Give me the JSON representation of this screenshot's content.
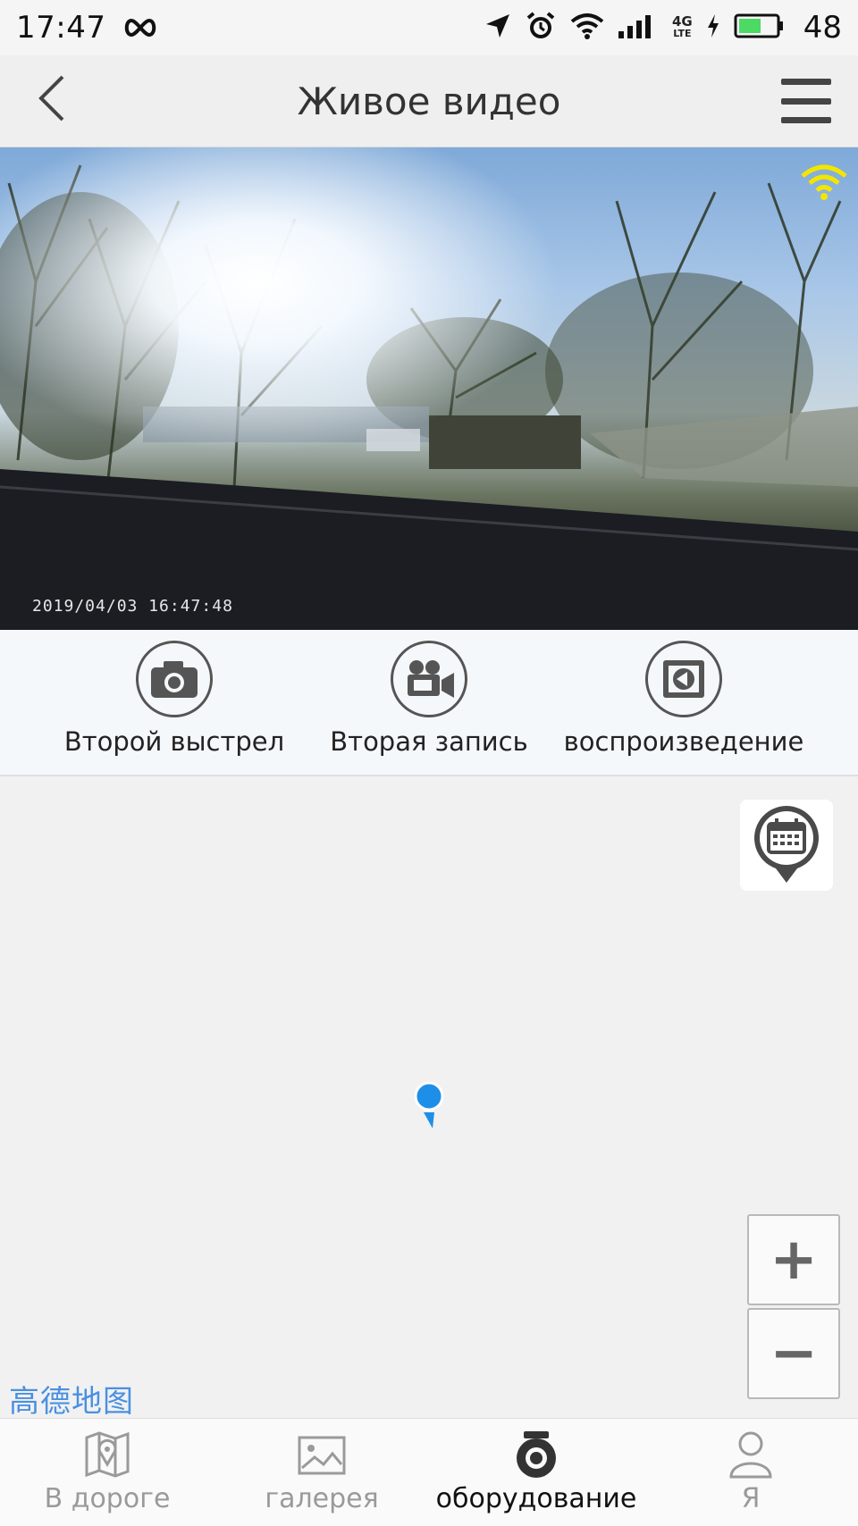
{
  "status_bar": {
    "time": "17:47",
    "battery_percent": "48",
    "network_label": "4G",
    "network_sub": "LTE",
    "icons": [
      "infinity-icon",
      "location-arrow-icon",
      "alarm-icon",
      "wifi-icon",
      "signal-icon",
      "charging-icon",
      "battery-icon"
    ]
  },
  "header": {
    "title": "Живое видео",
    "back_icon": "chevron-left-icon",
    "menu_icon": "hamburger-menu-icon"
  },
  "video": {
    "timestamp": "2019/04/03  16:47:48",
    "wifi_color": "#f2e600"
  },
  "controls": [
    {
      "label": "Второй выстрел",
      "icon": "camera-icon"
    },
    {
      "label": "Вторая запись",
      "icon": "video-camera-icon"
    },
    {
      "label": "воспроизведение",
      "icon": "playback-icon"
    }
  ],
  "map": {
    "logo": "高德地图",
    "zoom_in": "+",
    "zoom_out": "−",
    "pin_color": "#1e8fe8"
  },
  "nav": {
    "items": [
      {
        "label": "В дороге",
        "icon": "map-icon",
        "active": false
      },
      {
        "label": "галерея",
        "icon": "gallery-icon",
        "active": false
      },
      {
        "label": "оборудование",
        "icon": "dashcam-icon",
        "active": true
      },
      {
        "label": "Я",
        "icon": "user-icon",
        "active": false
      }
    ]
  }
}
